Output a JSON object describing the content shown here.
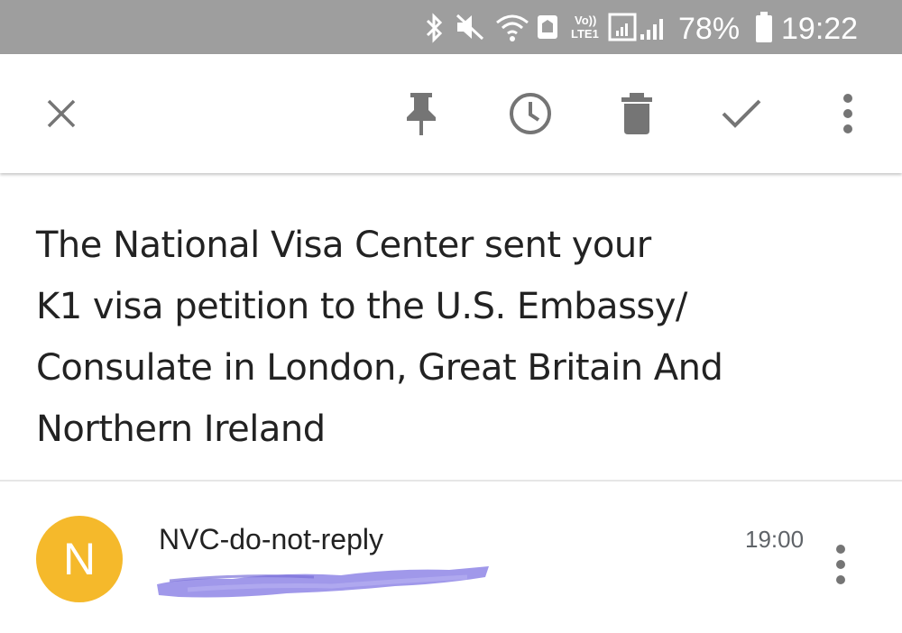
{
  "status_bar": {
    "lte_badge_top": "Vo))",
    "lte_badge_bottom": "LTE1",
    "battery_percent": "78%",
    "clock": "19:22",
    "icons": [
      "bluetooth-icon",
      "mute-icon",
      "wifi-icon",
      "notification-icon",
      "volte-icon",
      "signal-icon",
      "signal-icon",
      "battery-icon"
    ]
  },
  "toolbar": {
    "icons": [
      "close-icon",
      "pin-icon",
      "snooze-icon",
      "delete-icon",
      "done-icon",
      "more-vert-icon"
    ]
  },
  "email": {
    "subject_lines": [
      "The National Visa Center sent your",
      "K1 visa petition to the U.S. Embassy/",
      "Consulate in London, Great Britain And",
      "Northern Ireland"
    ],
    "avatar_letter": "N",
    "sender": "NVC-do-not-reply",
    "time": "19:00"
  },
  "colors": {
    "status_bar": "#9e9e9e",
    "avatar": "#f5b92b",
    "icon_gray": "#757575",
    "redaction": "#8f86e6"
  }
}
